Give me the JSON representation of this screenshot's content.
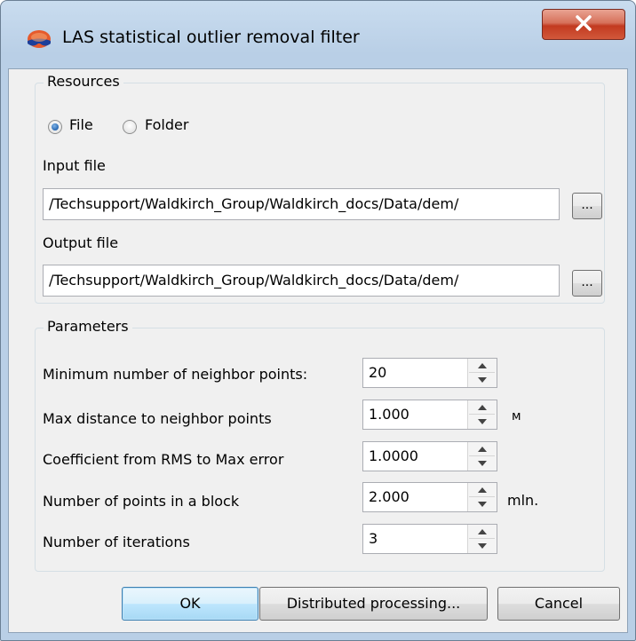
{
  "window": {
    "title": "LAS statistical outlier removal filter"
  },
  "resources": {
    "group_label": "Resources",
    "mode_options": [
      {
        "label": "File",
        "selected": true
      },
      {
        "label": "Folder",
        "selected": false
      }
    ],
    "input_file": {
      "label": "Input file",
      "value": "/Techsupport/Waldkirch_Group/Waldkirch_docs/Data/dem/",
      "browse_label": "..."
    },
    "output_file": {
      "label": "Output file",
      "value": "/Techsupport/Waldkirch_Group/Waldkirch_docs/Data/dem/",
      "browse_label": "..."
    }
  },
  "parameters": {
    "group_label": "Parameters",
    "rows": [
      {
        "label": "Minimum number of neighbor points:",
        "value": "20",
        "unit": ""
      },
      {
        "label": "Max distance to neighbor points",
        "value": "1.000",
        "unit": "м"
      },
      {
        "label": "Coefficient from RMS to Max error",
        "value": "1.0000",
        "unit": ""
      },
      {
        "label": "Number of points in a block",
        "value": "2.000",
        "unit": "mln."
      },
      {
        "label": "Number of iterations",
        "value": "3",
        "unit": ""
      }
    ]
  },
  "buttons": {
    "ok": "OK",
    "distributed": "Distributed processing...",
    "cancel": "Cancel"
  },
  "colors": {
    "window_frame": "#b9cfe6",
    "close_button": "#c94a30",
    "dialog_background": "#f0f0f0",
    "default_button": "#bee6fd"
  },
  "icons": {
    "app": "stereo-glasses-icon",
    "close": "close-icon",
    "spin_up": "spin-up-icon",
    "spin_down": "spin-down-icon"
  }
}
